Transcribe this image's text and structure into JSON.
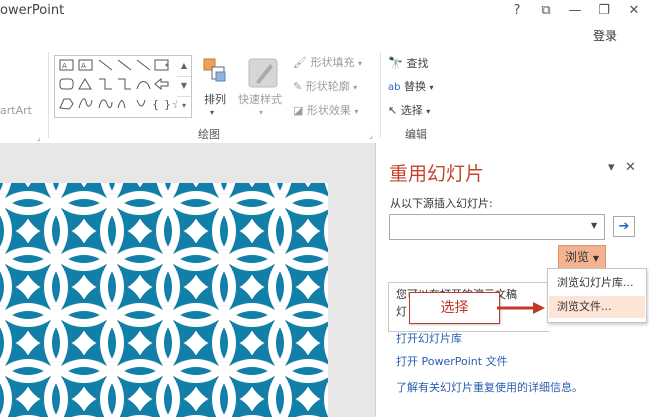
{
  "window": {
    "title": "owerPoint",
    "help": "?",
    "restore_ribbon": "⧉",
    "minimize": "—",
    "maximize": "❐",
    "close": "✕",
    "login": "登录"
  },
  "ribbon": {
    "smartart_label": "artArt",
    "draw_group_label": "绘图",
    "arrange_label": "排列",
    "quick_styles_label": "快速样式",
    "shape_fill": "形状填充",
    "shape_outline": "形状轮廓",
    "shape_effects": "形状效果",
    "edit_group_label": "编辑",
    "find": "查找",
    "replace": "替换",
    "select": "选择"
  },
  "pane": {
    "title": "重用幻灯片",
    "source_label": "从以下源插入幻灯片:",
    "source_value": "",
    "browse_button": "浏览",
    "menu": [
      "浏览幻灯片库...",
      "浏览文件..."
    ],
    "info_line1": "您可以在打开的演示文稿",
    "info_line2": "灯",
    "open_library_link": "打开幻灯片库",
    "open_ppt_link": "打开 PowerPoint 文件",
    "learn_more_link": "了解有关幻灯片重复使用的详细信息。"
  },
  "annotation": {
    "callout_text": "选择"
  },
  "colors": {
    "pane_title": "#c6442c",
    "slide_bg": "#127fa8",
    "browse_btn": "#f3b391",
    "callout_red": "#c0392b",
    "link_blue": "#2a5db0"
  }
}
